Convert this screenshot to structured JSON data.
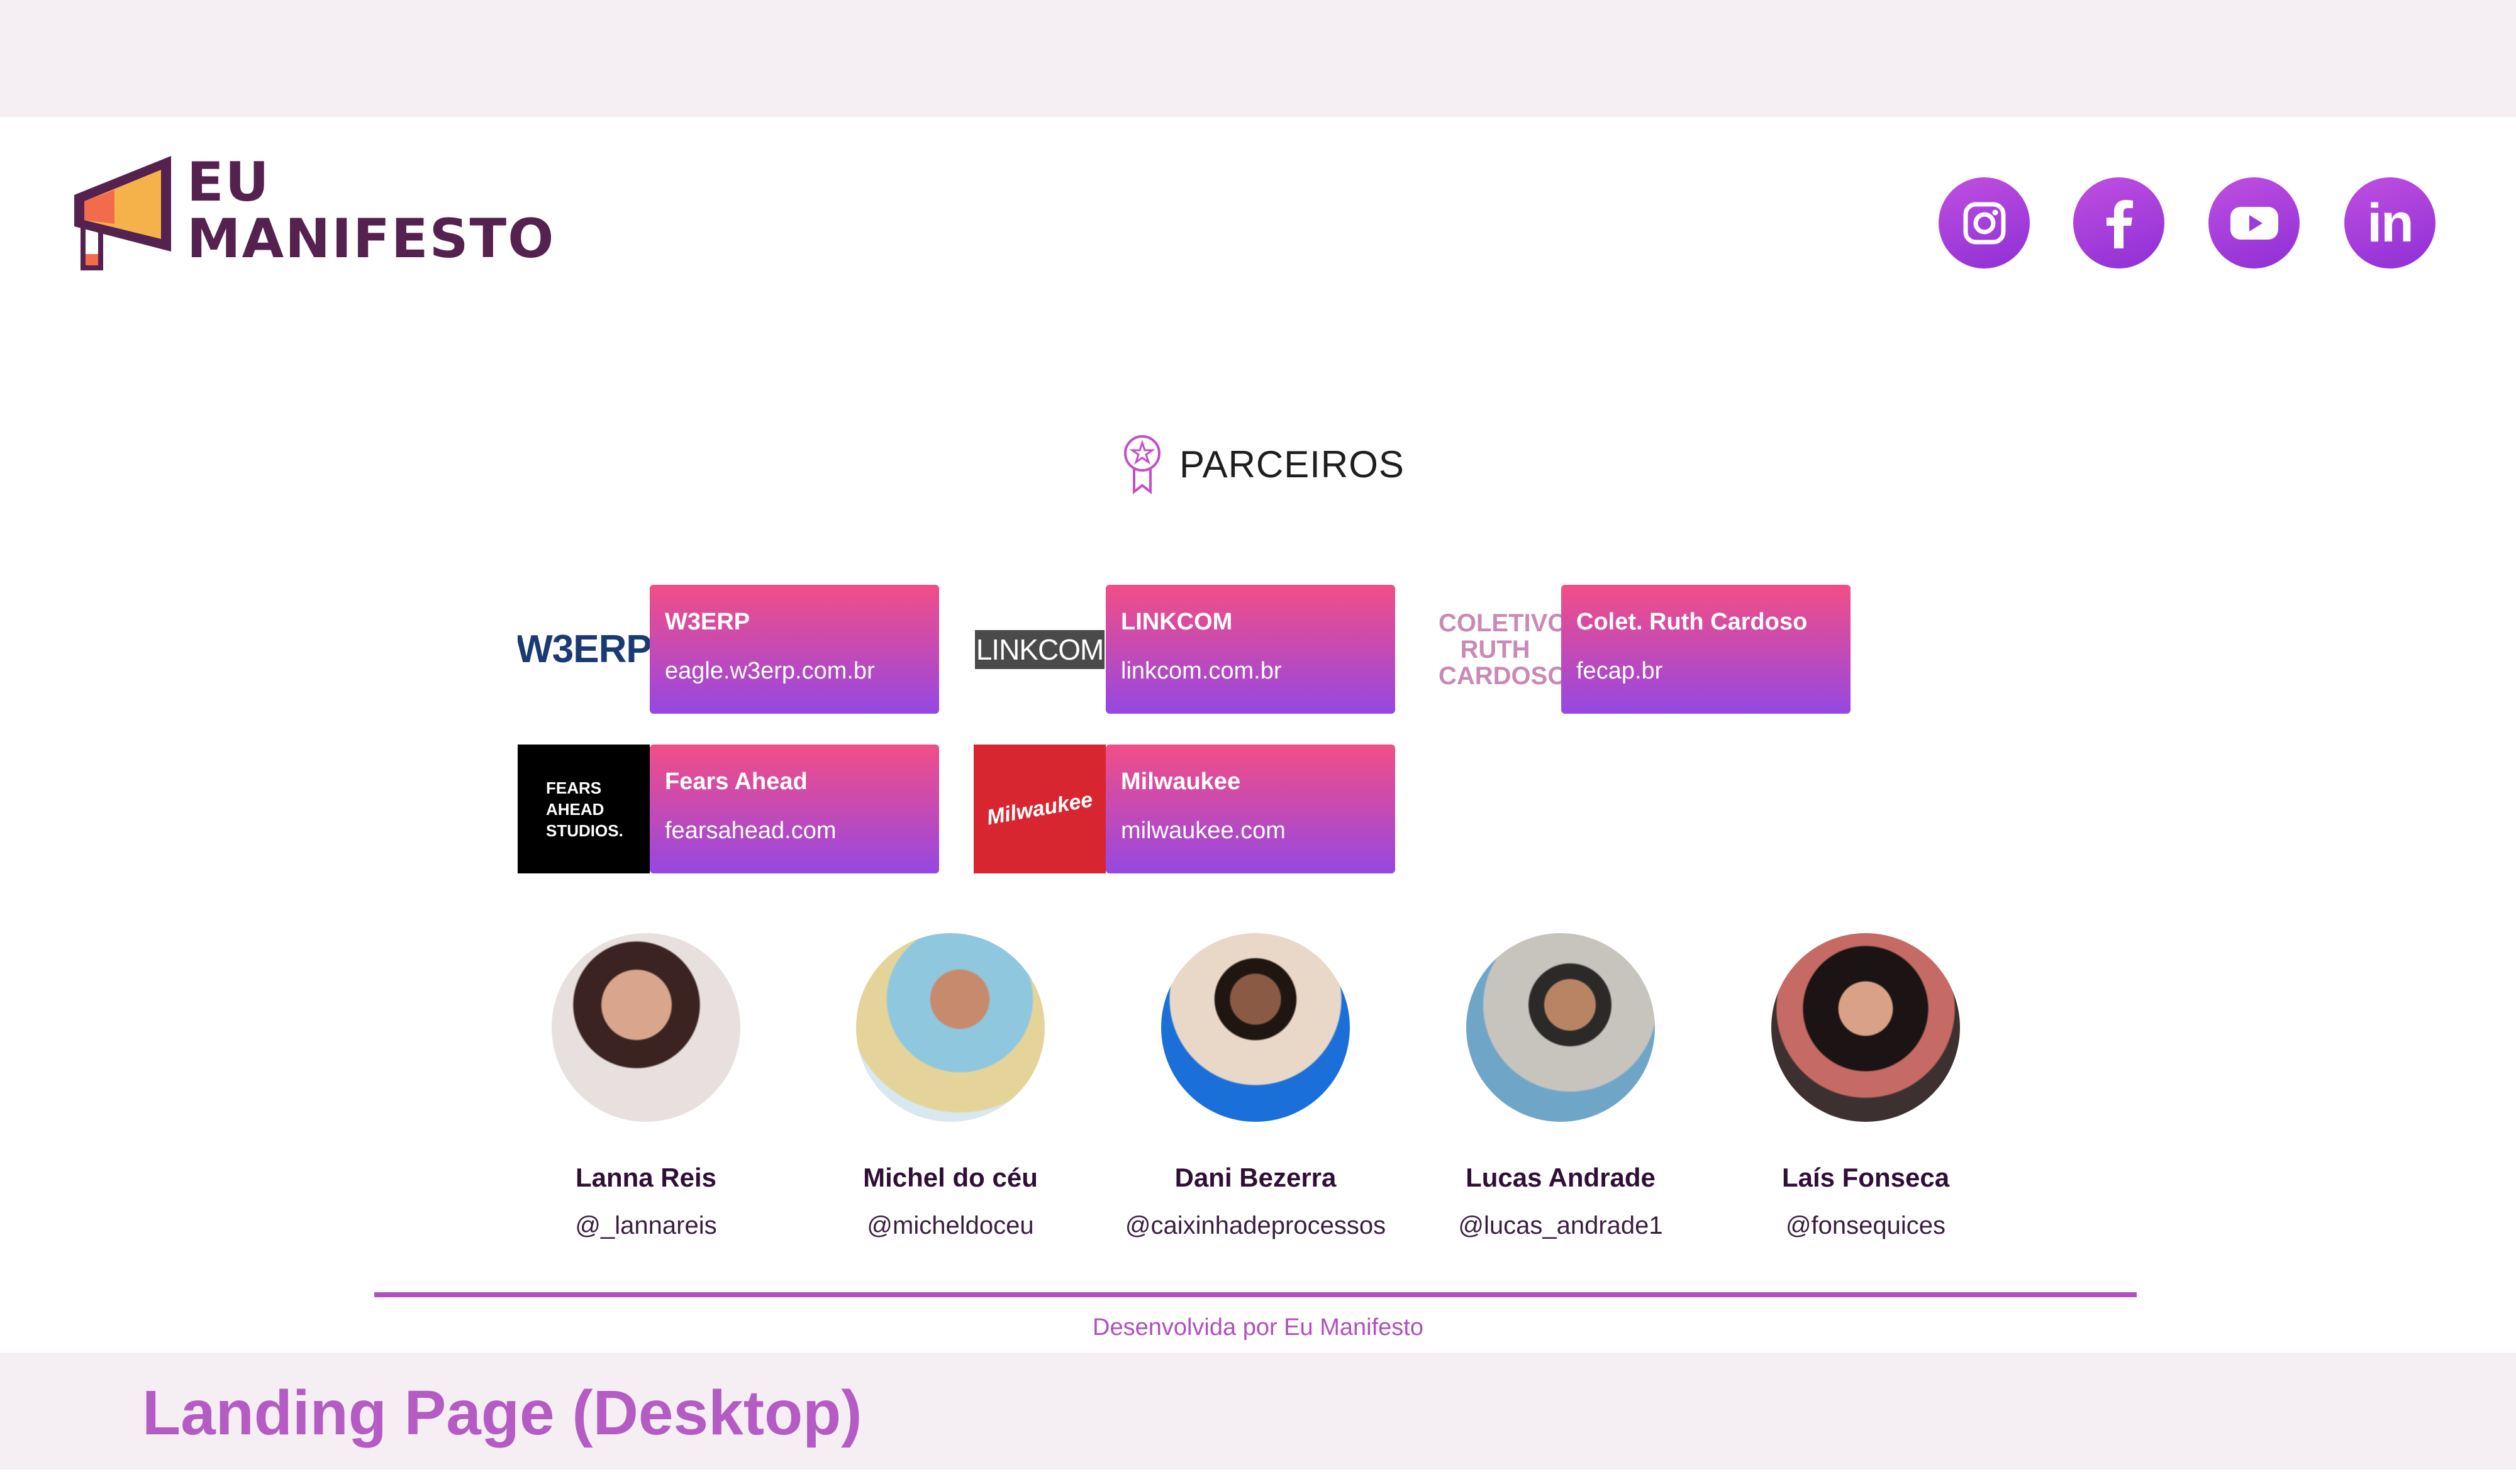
{
  "header": {
    "logo": {
      "line1": "EU",
      "line2": "MANIFESTO",
      "icon": "megaphone-icon"
    },
    "social": [
      {
        "name": "instagram",
        "icon": "instagram-icon"
      },
      {
        "name": "facebook",
        "icon": "facebook-icon"
      },
      {
        "name": "youtube",
        "icon": "youtube-icon"
      },
      {
        "name": "linkedin",
        "icon": "linkedin-icon",
        "text": "in"
      }
    ]
  },
  "partners_section": {
    "title": "PARCEIROS",
    "icon": "award-ribbon-icon",
    "partners": [
      {
        "logo_text": "W3ERP",
        "name": "W3ERP",
        "url": "eagle.w3erp.com.br"
      },
      {
        "logo_text": "LINKCOM",
        "name": "LINKCOM",
        "url": "linkcom.com.br"
      },
      {
        "logo_text": "COLETIVO RUTH CARDOSO",
        "name": "Colet. Ruth Cardoso",
        "url": "fecap.br"
      },
      {
        "logo_text": "FEARS AHEAD STUDIOS.",
        "name": "Fears Ahead",
        "url": "fearsahead.com"
      },
      {
        "logo_text": "Milwaukee",
        "name": "Milwaukee",
        "url": "milwaukee.com"
      }
    ]
  },
  "team": [
    {
      "name": "Lanna Reis",
      "handle": "@_lannareis"
    },
    {
      "name": "Michel do céu",
      "handle": "@micheldoceu"
    },
    {
      "name": "Dani Bezerra",
      "handle": "@caixinhadeprocessos"
    },
    {
      "name": "Lucas Andrade",
      "handle": "@lucas_andrade1"
    },
    {
      "name": "Laís Fonseca",
      "handle": "@fonsequices"
    }
  ],
  "footer": {
    "credit": "Desenvolvida por Eu Manifesto"
  },
  "caption": {
    "title": "Landing Page (Desktop)"
  },
  "colors": {
    "accent_purple": "#b14fc0",
    "gradient_pink": "#f24e86",
    "gradient_violet": "#9548e2",
    "band": "#f5eff4"
  }
}
